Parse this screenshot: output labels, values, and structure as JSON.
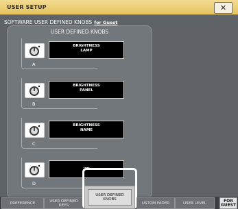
{
  "window": {
    "title": "USER SETUP",
    "close_label": "✕"
  },
  "header": {
    "label": "SOFTWARE USER DEFINED KNOBS",
    "user": "for Guest"
  },
  "panel": {
    "title": "USER DEFINED KNOBS",
    "knobs": [
      {
        "letter": "A",
        "line1": "BRIGHTNESS",
        "line2": "LAMP"
      },
      {
        "letter": "B",
        "line1": "BRIGHTNESS",
        "line2": "PANEL"
      },
      {
        "letter": "C",
        "line1": "BRIGHTNESS",
        "line2": "NAME"
      },
      {
        "letter": "D",
        "line1": "----",
        "line2": ""
      }
    ]
  },
  "tabs": [
    {
      "label_1": "PREFERENCE",
      "label_2": ""
    },
    {
      "label_1": "USER DEFINED",
      "label_2": "KEYS"
    },
    {
      "label_1": "USER DEFINED",
      "label_2": "KNOBS"
    },
    {
      "label_1": "USTOM FADER",
      "label_2": ""
    },
    {
      "label_1": "USER LEVEL",
      "label_2": ""
    },
    {
      "label_1": "FOR",
      "label_2": "GUEST"
    }
  ],
  "colors": {
    "titlebar": "#e5c25c",
    "panel_bg": "#72777c",
    "active_tab": "#dedede"
  }
}
